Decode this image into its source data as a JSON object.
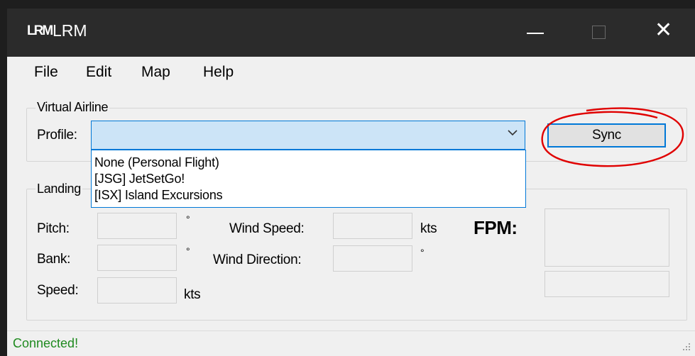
{
  "window": {
    "logo": "LRM",
    "title": "LRM"
  },
  "menu": [
    "File",
    "Edit",
    "Map",
    "Help"
  ],
  "virtual_airline": {
    "group_label": "Virtual Airline",
    "profile_label": "Profile:",
    "profile_value": "",
    "options": [
      "None (Personal Flight)",
      "[JSG] JetSetGo!",
      "[ISX] Island Excursions"
    ],
    "sync_label": "Sync"
  },
  "landing": {
    "group_label": "Landing",
    "pitch_label": "Pitch:",
    "bank_label": "Bank:",
    "speed_label": "Speed:",
    "wind_speed_label": "Wind Speed:",
    "wind_direction_label": "Wind Direction:",
    "degree_symbol": "°",
    "kts_unit": "kts",
    "fpm_label": "FPM:",
    "values": {
      "pitch": "",
      "bank": "",
      "speed": "",
      "wind_speed": "",
      "wind_direction": "",
      "fpm": "",
      "fpm_secondary": ""
    }
  },
  "status": {
    "text": "Connected!",
    "color": "#1f8a1f"
  },
  "colors": {
    "accent": "#0078d7",
    "annotation": "#e00000",
    "titlebar": "#2b2b2b"
  }
}
